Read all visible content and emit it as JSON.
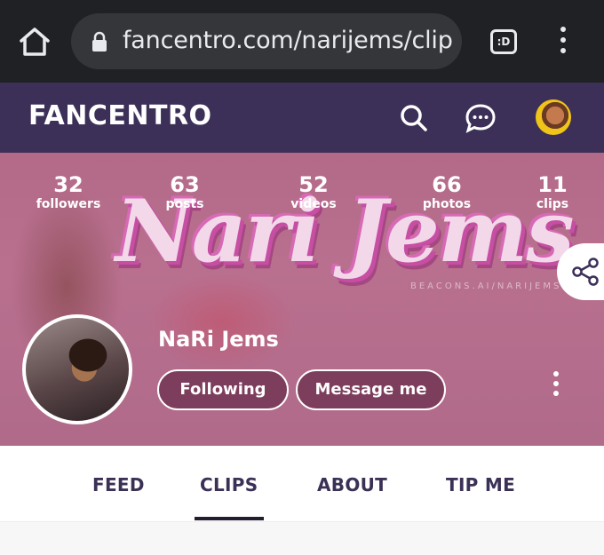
{
  "browser": {
    "url": "fancentro.com/narijems/clip",
    "tab_count": ":D"
  },
  "header": {
    "logo": "FANCENTRO"
  },
  "profile": {
    "cover_title": "Nari Jems",
    "cover_watermark": "BEACONS.AI/NARIJEMS",
    "name": "NaRi Jems",
    "stats": [
      {
        "num": "32",
        "label": "followers"
      },
      {
        "num": "63",
        "label": "posts"
      },
      {
        "num": "52",
        "label": "videos"
      },
      {
        "num": "66",
        "label": "photos"
      },
      {
        "num": "11",
        "label": "clips"
      }
    ],
    "following_label": "Following",
    "message_label": "Message me"
  },
  "tabs": [
    {
      "label": "FEED"
    },
    {
      "label": "CLIPS",
      "active": true
    },
    {
      "label": "ABOUT"
    },
    {
      "label": "TIP ME"
    }
  ],
  "colors": {
    "browser_bg": "#202124",
    "header_bg": "#3c3058",
    "cover_bg": "#b36a88",
    "tab_text": "#3b3156"
  },
  "icons": {
    "home": "home-icon",
    "lock": "lock-icon",
    "search": "search-icon",
    "chat": "chat-bubble-icon",
    "share": "share-icon",
    "more": "more-vertical-icon"
  }
}
